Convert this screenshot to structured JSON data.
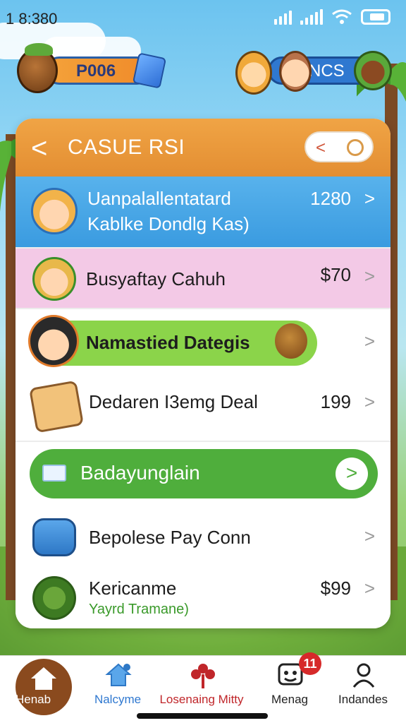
{
  "status_bar": {
    "time": "1 8:380"
  },
  "top": {
    "left_pill_text": "P006",
    "right_pill_text": "NCS"
  },
  "header": {
    "back_glyph": "<",
    "title": "CASUE RSI",
    "share_glyph": "<",
    "toggle_glyph": "O"
  },
  "rows": [
    {
      "line1": "Uanpalallentatard",
      "line2": "Kablke Dondlg Kas)",
      "value": "1280"
    },
    {
      "title": "Busyaftay Cahuh",
      "value": "$70"
    },
    {
      "title": "Namastied Dategis"
    },
    {
      "title": "Dedaren I3emg Deal",
      "value": "199"
    }
  ],
  "green_button": {
    "label": "Badayunglain",
    "arrow": ">"
  },
  "rows2": [
    {
      "title": "Bepolese Pay Conn"
    },
    {
      "title": "Kericanme",
      "subtitle": "Yayrd Tramane)",
      "value": "$99"
    }
  ],
  "chevron": ">",
  "nav": {
    "items": [
      {
        "label": "Henab"
      },
      {
        "label": "Nalcyme"
      },
      {
        "label": "Losenaing Mitty"
      },
      {
        "label": "Menag"
      },
      {
        "label": "Indandes"
      }
    ],
    "badge": "11"
  },
  "colors": {
    "header_orange": "#e38e32",
    "row_blue": "#3a9be0",
    "row_pink": "#f3c9e6",
    "chip_green": "#8bd44a",
    "button_green": "#4fae3c",
    "home_brown": "#8a4a1e",
    "badge_red": "#d62a2a",
    "nav_active_blue": "#2f78d0",
    "nav_active_red": "#c0262a"
  }
}
